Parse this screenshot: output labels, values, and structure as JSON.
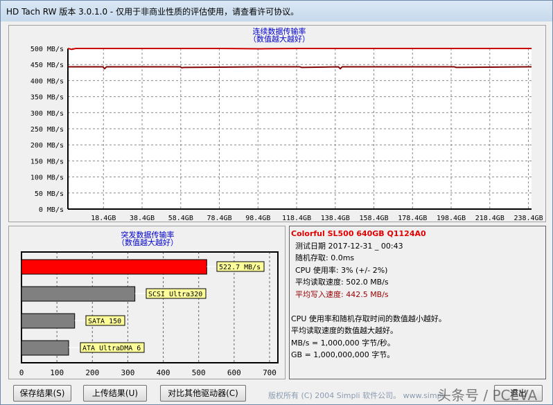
{
  "window": {
    "title": "HD Tach RW 版本 3.0.1.0  - 仅用于非商业性质的评估使用，请查看许可协议。"
  },
  "sequential": {
    "title1": "连续数据传输率",
    "title2": "（数值越大越好）",
    "y_ticks": [
      "500 MB/s",
      "450 MB/s",
      "400 MB/s",
      "350 MB/s",
      "300 MB/s",
      "250 MB/s",
      "200 MB/s",
      "150 MB/s",
      "100 MB/s",
      "50 MB/s",
      "0 MB/s"
    ],
    "x_ticks": [
      "18.4GB",
      "38.4GB",
      "58.4GB",
      "78.4GB",
      "98.4GB",
      "118.4GB",
      "138.4GB",
      "158.4GB",
      "178.4GB",
      "198.4GB",
      "218.4GB",
      "238.4GB"
    ],
    "read_color": "#cc0000",
    "write_color": "#800000"
  },
  "chart_data": [
    {
      "type": "line",
      "title": "连续数据传输率 （数值越大越好）",
      "ylim": [
        0,
        500
      ],
      "xlim": [
        0,
        240
      ],
      "series": [
        {
          "name": "read",
          "approx_value": 502.0,
          "x": [
            0,
            2,
            4,
            40,
            60,
            80,
            100,
            120,
            140,
            160,
            180,
            200,
            220,
            240
          ],
          "y": [
            500,
            497,
            500,
            500,
            500,
            500,
            499,
            500,
            500,
            500,
            500,
            500,
            500,
            500
          ]
        },
        {
          "name": "write",
          "approx_value": 442.5,
          "x": [
            0,
            18,
            19,
            20,
            58,
            59,
            60,
            100,
            120,
            121,
            140,
            141,
            142,
            160,
            200,
            201,
            240
          ],
          "y": [
            443,
            443,
            437,
            443,
            443,
            440,
            441,
            443,
            443,
            441,
            443,
            437,
            443,
            443,
            443,
            441,
            443
          ]
        }
      ]
    },
    {
      "type": "bar",
      "title": "突发数据传输率 （数值越大越好）",
      "xlim": [
        0,
        700
      ],
      "ticks": [
        "0",
        "100",
        "200",
        "300",
        "400",
        "500",
        "600",
        "700"
      ],
      "categories": [
        "522.7 MB/s",
        "SCSI Ultra320",
        "SATA 150",
        "ATA UltraDMA 6"
      ],
      "values": [
        522.7,
        320,
        150,
        133
      ],
      "colors": [
        "#ff0000",
        "#808080",
        "#808080",
        "#808080"
      ]
    }
  ],
  "burst": {
    "title1": "突发数据传输率",
    "title2": "（数值越大越好）"
  },
  "info": {
    "drive": "Colorful SL500 640GB Q1124A0",
    "date": "测试日期 2017-12-31 _ 00:43",
    "random": "随机存取: 0.0ms",
    "cpu": "CPU 使用率: 3% (+/- 2%)",
    "read": "平均读取速度: 502.0 MB/s",
    "write": "平均写入速度: 442.5 MB/s",
    "note1": "CPU 使用率和随机存取时间的数值越小越好。",
    "note2": "平均读取速度的数值越大越好。",
    "note3": "MB/s = 1,000,000 字节/秒。",
    "note4": "GB = 1,000,000,000 字节。"
  },
  "buttons": {
    "save": "保存结果(S)",
    "upload": "上传结果(U)",
    "compare": "对比其他驱动器(C)",
    "exit": "退出"
  },
  "footer": {
    "copyright": "版权所有 (C) 2004 Simpli 软件公司。 www.simpli",
    "watermark": "头条号 / PCEVA"
  }
}
